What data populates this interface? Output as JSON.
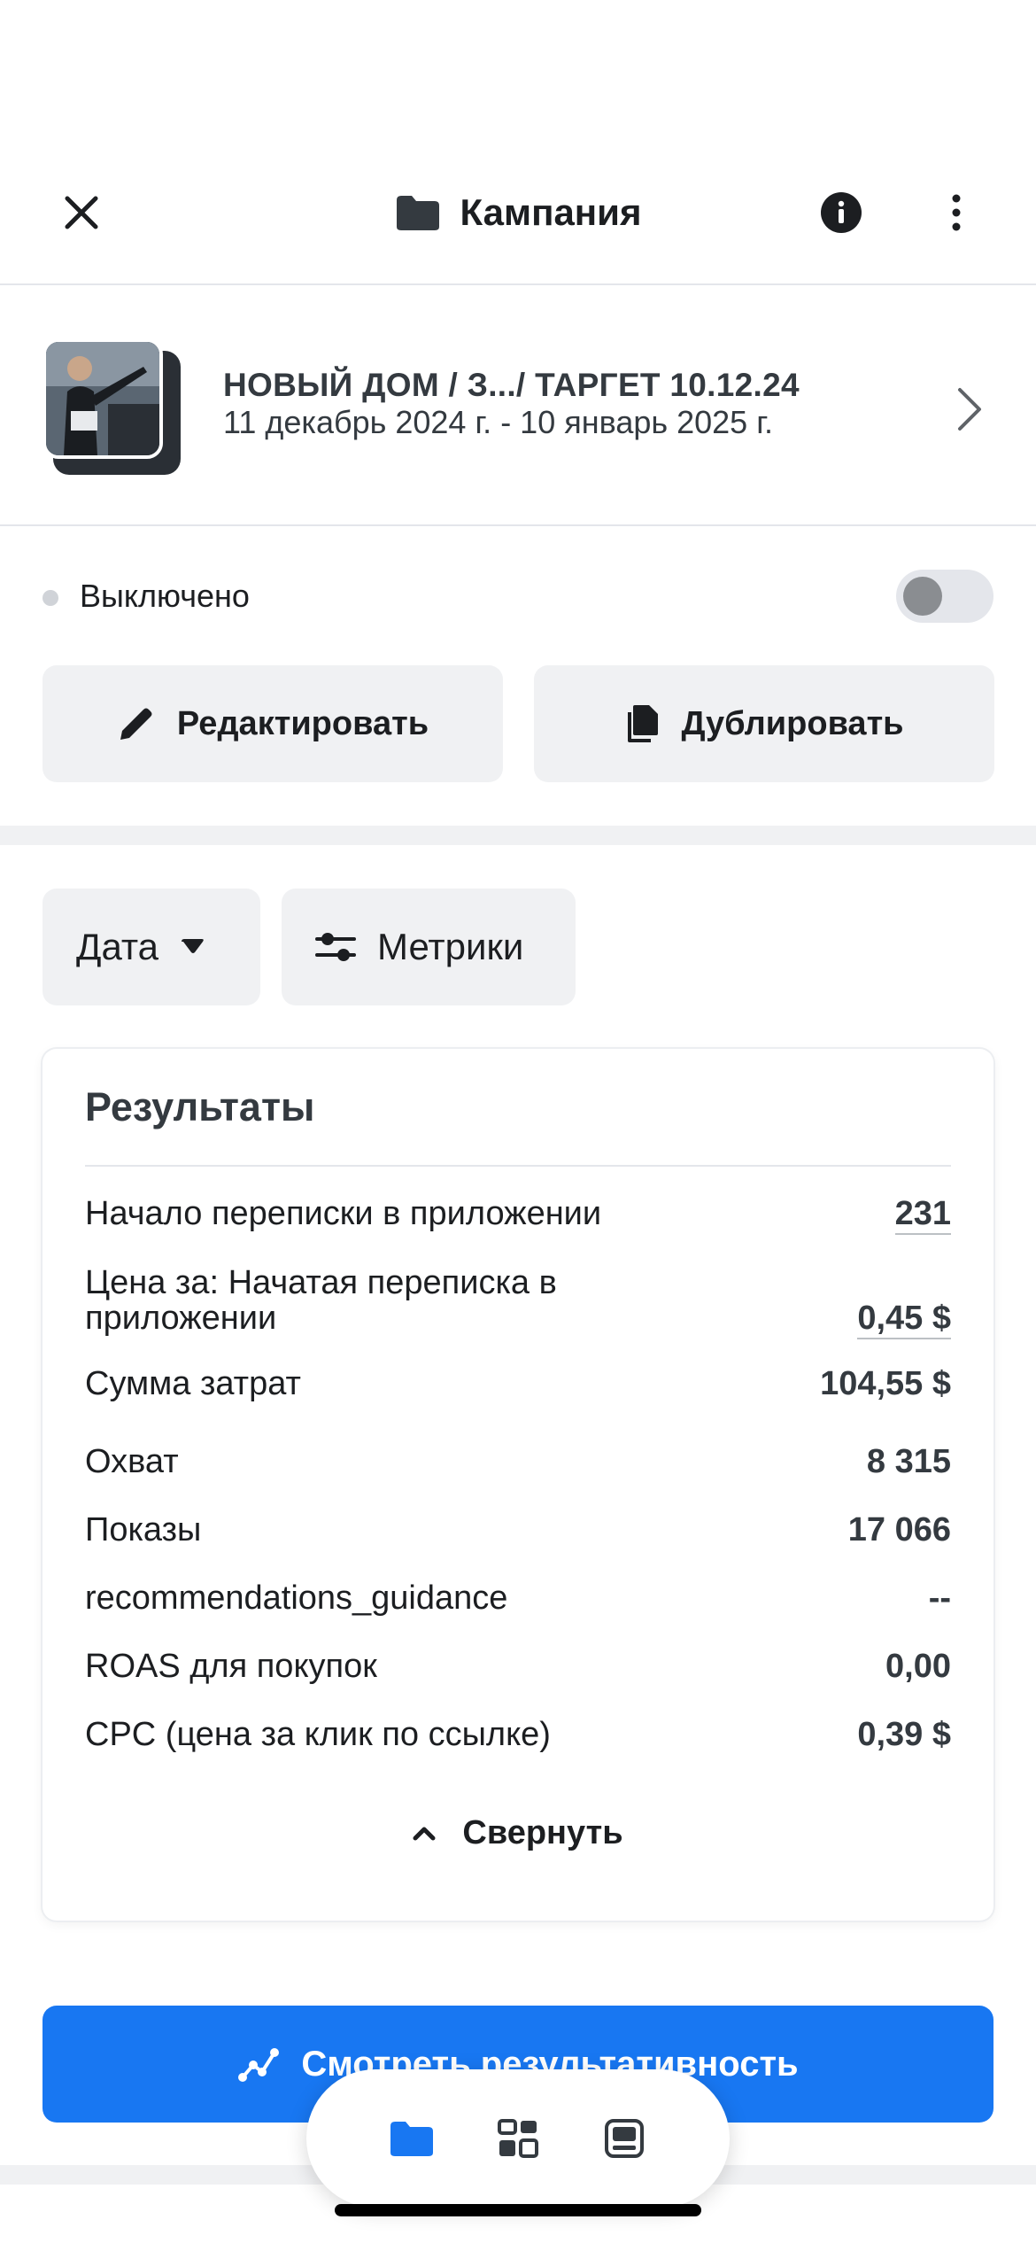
{
  "header": {
    "title": "Кампания",
    "close_icon": "close-icon",
    "folder_icon": "folder-icon",
    "info_icon": "info-icon",
    "more_icon": "more-vertical-icon"
  },
  "campaign": {
    "name": "НОВЫЙ ДОМ / З.../ ТАРГЕТ 10.12.24",
    "dates": "11 декабрь 2024 г. - 10 январь 2025 г."
  },
  "status": {
    "label": "Выключено",
    "enabled": false
  },
  "actions": {
    "edit_label": "Редактировать",
    "duplicate_label": "Дублировать"
  },
  "filters": {
    "date_label": "Дата",
    "metrics_label": "Метрики"
  },
  "results": {
    "title": "Результаты",
    "rows": [
      {
        "label": "Начало переписки в приложении",
        "value": "231"
      },
      {
        "label": "Цена за: Начатая переписка в приложении",
        "value": "0,45 $"
      },
      {
        "label": "Сумма затрат",
        "value": "104,55 $"
      },
      {
        "label": "Охват",
        "value": "8 315"
      },
      {
        "label": "Показы",
        "value": "17 066"
      },
      {
        "label": "recommendations_guidance",
        "value": "--"
      },
      {
        "label": "ROAS для покупок",
        "value": "0,00"
      },
      {
        "label": "CPC (цена за клик по ссылке)",
        "value": "0,39 $"
      }
    ],
    "collapse_label": "Свернуть"
  },
  "primary_action": {
    "label": "Смотреть результативность"
  },
  "tabbar": {
    "items": [
      "folder-icon",
      "grid-icon",
      "ad-preview-icon"
    ],
    "active": "folder-icon"
  },
  "colors": {
    "accent": "#1877f2",
    "text": "#1c1e21",
    "button_bg": "#f0f1f3"
  }
}
